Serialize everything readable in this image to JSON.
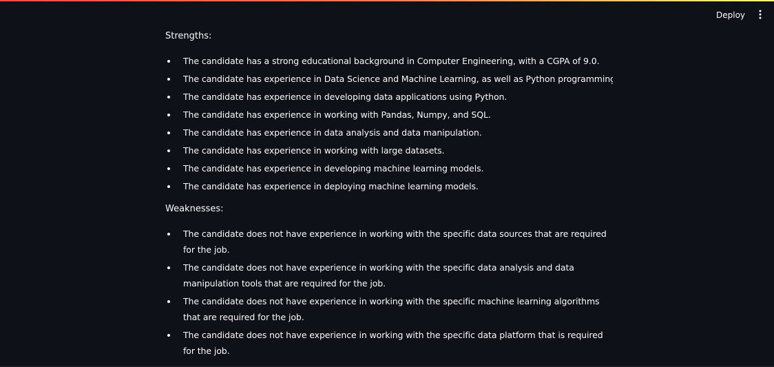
{
  "header": {
    "deploy_label": "Deploy",
    "menu_icon": "vertical-dots-icon"
  },
  "strengths": {
    "heading": "Strengths:",
    "items": [
      "The candidate has a strong educational background in Computer Engineering, with a CGPA of 9.0.",
      "The candidate has experience in Data Science and Machine Learning, as well as Python programming.",
      "The candidate has experience in developing data applications using Python.",
      "The candidate has experience in working with Pandas, Numpy, and SQL.",
      "The candidate has experience in data analysis and data manipulation.",
      "The candidate has experience in working with large datasets.",
      "The candidate has experience in developing machine learning models.",
      "The candidate has experience in deploying machine learning models."
    ]
  },
  "weaknesses": {
    "heading": "Weaknesses:",
    "items": [
      "The candidate does not have experience in working with the specific data sources that are required for the job.",
      "The candidate does not have experience in working with the specific data analysis and data manipulation tools that are required for the job.",
      "The candidate does not have experience in working with the specific machine learning algorithms that are required for the job.",
      "The candidate does not have experience in working with the specific data platform that is required for the job."
    ]
  },
  "colors": {
    "background": "#0e1117",
    "text": "#fafafa",
    "accent": "#ff4b4b"
  }
}
